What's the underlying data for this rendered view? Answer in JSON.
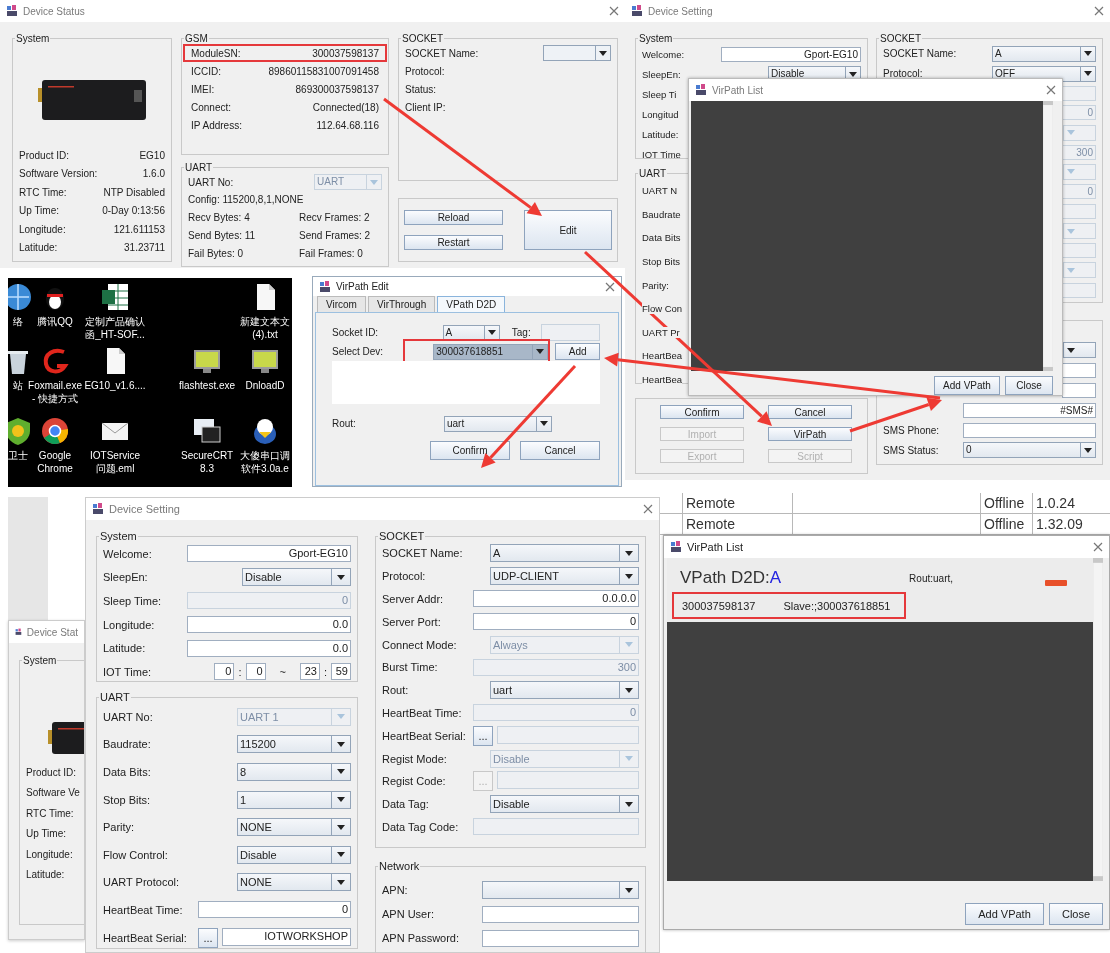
{
  "device_status": {
    "title": "Device Status",
    "system": {
      "title": "System",
      "rows": [
        {
          "label": "Product ID:",
          "value": "EG10"
        },
        {
          "label": "Software Version:",
          "value": "1.6.0"
        },
        {
          "label": "RTC Time:",
          "value": "NTP Disabled"
        },
        {
          "label": "Up Time:",
          "value": "0-Day 0:13:56"
        },
        {
          "label": "Longitude:",
          "value": "121.611153"
        },
        {
          "label": "Latitude:",
          "value": "31.23711"
        }
      ]
    },
    "gsm": {
      "title": "GSM",
      "rows": [
        {
          "label": "ModuleSN:",
          "value": "300037598137",
          "highlighted": true
        },
        {
          "label": "ICCID:",
          "value": "89860115831007091458",
          "highlighted": false
        },
        {
          "label": "IMEI:",
          "value": "869300037598137",
          "highlighted": false
        },
        {
          "label": "Connect:",
          "value": "Connected(18)",
          "highlighted": false
        },
        {
          "label": "IP Address:",
          "value": "112.64.68.116",
          "highlighted": false
        }
      ]
    },
    "uart": {
      "title": "UART",
      "uart_no": {
        "label": "UART No:",
        "kind": "select",
        "value": "UART",
        "disabled": true
      },
      "config": "Config: 115200,8,1,NONE",
      "stats": [
        [
          "Recv Bytes: 4",
          "Recv Frames: 2"
        ],
        [
          "Send Bytes: 11",
          "Send Frames: 2"
        ],
        [
          "Fail Bytes: 0",
          "Fail Frames: 0"
        ]
      ]
    },
    "socket": {
      "title": "SOCKET",
      "name_field": {
        "label": "SOCKET Name:",
        "kind": "select",
        "disabled": false
      },
      "labels": [
        "Protocol:",
        "Status:",
        "Client IP:"
      ]
    },
    "buttons": [
      "Reload",
      "Restart",
      "Edit"
    ]
  },
  "device_setting_top": {
    "title": "Device Setting",
    "system": {
      "title": "System",
      "rows": [
        {
          "label": "Welcome:",
          "kind": "input",
          "value": "Gport-EG10",
          "disabled": false
        },
        {
          "label": "SleepEn:",
          "kind": "select",
          "value": "Disable",
          "disabled": false
        },
        {
          "label": "Sleep Ti"
        },
        {
          "label": "Longitud"
        },
        {
          "label": "Latitude:"
        },
        {
          "label": "IOT Time"
        }
      ]
    },
    "uart": {
      "title": "UART",
      "rows": [
        {
          "label": "UART N"
        },
        {
          "label": "Baudrate"
        },
        {
          "label": "Data Bits"
        },
        {
          "label": "Stop Bits"
        },
        {
          "label": "Parity:"
        },
        {
          "label": "Flow Con"
        },
        {
          "label": "UART Pr"
        },
        {
          "label": "HeartBea"
        },
        {
          "label": "HeartBea"
        }
      ]
    },
    "socket": {
      "title": "SOCKET",
      "rows": [
        {
          "label": "SOCKET Name:",
          "kind": "select",
          "value": "A",
          "disabled": false
        },
        {
          "label": "Protocol:",
          "kind": "select",
          "value": "OFF",
          "disabled": false
        },
        {
          "kind": "stub_input",
          "disabled": true
        },
        {
          "kind": "stub_input",
          "value": "0",
          "disabled": true
        },
        {
          "kind": "stub_select",
          "disabled": true
        },
        {
          "kind": "stub_input",
          "value": "300",
          "disabled": true
        },
        {
          "kind": "stub_select",
          "disabled": true
        },
        {
          "kind": "stub_input",
          "value": "0",
          "disabled": true
        },
        {
          "kind": "stub_input",
          "disabled": true
        },
        {
          "kind": "stub_select",
          "disabled": true
        },
        {
          "kind": "stub_input",
          "disabled": true
        },
        {
          "kind": "stub_select",
          "disabled": true
        },
        {
          "kind": "stub_input",
          "disabled": true
        }
      ]
    },
    "sms": {
      "rows": [
        {
          "kind": "stub_select",
          "disabled": false
        },
        {
          "kind": "stub_input",
          "disabled": false
        },
        {
          "kind": "stub_input",
          "disabled": false
        },
        {
          "kind": "input",
          "value": "#SMS#",
          "disabled": false
        },
        {
          "label": "SMS Phone:",
          "kind": "input",
          "disabled": false
        },
        {
          "label": "SMS Status:",
          "kind": "select",
          "value": "0",
          "disabled": false
        }
      ]
    },
    "buttons": [
      {
        "label": "Confirm",
        "disabled": false
      },
      {
        "label": "Cancel",
        "disabled": false
      },
      {
        "label": "Import",
        "disabled": true
      },
      {
        "label": "VirPath",
        "disabled": false
      },
      {
        "label": "Export",
        "disabled": true
      },
      {
        "label": "Script",
        "disabled": true
      }
    ]
  },
  "virpath_list_top": {
    "title": "VirPath List",
    "buttons": [
      "Add VPath",
      "Close"
    ]
  },
  "desktop": {
    "icons": [
      {
        "kind": "globe",
        "label": "络"
      },
      {
        "kind": "penguin",
        "label": "腾讯QQ"
      },
      {
        "kind": "spreadsheet",
        "label": "定制产品确认函_HT-SOF..."
      },
      {
        "kind": "blank"
      },
      {
        "kind": "blank"
      },
      {
        "kind": "document",
        "label": "新建文本文\n(4).txt"
      },
      {
        "kind": "bin",
        "label": "站"
      },
      {
        "kind": "swoosh",
        "label": "Foxmail.exe\n- 快捷方式"
      },
      {
        "kind": "document",
        "label": "EG10_v1.6...."
      },
      {
        "kind": "blank"
      },
      {
        "kind": "monitor",
        "label": "flashtest.exe"
      },
      {
        "kind": "monitor",
        "label": "DnloadD"
      },
      {
        "kind": "shield",
        "label": "卫士"
      },
      {
        "kind": "browser",
        "label": "Google\nChrome"
      },
      {
        "kind": "envelope",
        "label": "IOTService\n问题.eml"
      },
      {
        "kind": "blank"
      },
      {
        "kind": "terminal",
        "label": "SecureCRT\n8.3"
      },
      {
        "kind": "bird",
        "label": "大傻串口调软件3.0a.e"
      }
    ]
  },
  "virpath_edit": {
    "title": "VirPath Edit",
    "tabs": [
      {
        "label": "Vircom",
        "selected": false
      },
      {
        "label": "VirThrough",
        "selected": false
      },
      {
        "label": "VPath D2D",
        "selected": true
      }
    ],
    "socket_id": {
      "label": "Socket ID:",
      "kind": "select",
      "value": "A",
      "disabled": false
    },
    "tag": {
      "label": "Tag:",
      "kind": "input",
      "disabled": true
    },
    "select_dev": {
      "label": "Select Dev:",
      "kind": "select",
      "value": "300037618851",
      "disabled": false,
      "highlighted": true
    },
    "add_button": "Add",
    "rout": {
      "label": "Rout:",
      "kind": "select",
      "value": "uart",
      "disabled": false
    },
    "buttons": [
      "Confirm",
      "Cancel"
    ]
  },
  "device_status_back": {
    "title": "Device Stat",
    "system_title": "System",
    "labels": [
      "Product ID:",
      "Software Ve",
      "RTC Time:",
      "Up Time:",
      "Longitude:",
      "Latitude:"
    ]
  },
  "device_setting": {
    "title": "Device Setting",
    "system": {
      "title": "System",
      "rows": [
        {
          "label": "Welcome:",
          "kind": "input",
          "value": "Gport-EG10",
          "disabled": false
        },
        {
          "label": "SleepEn:",
          "kind": "select",
          "value": "Disable",
          "disabled": false
        },
        {
          "label": "Sleep Time:",
          "kind": "input",
          "value": "0",
          "disabled": true
        },
        {
          "label": "Longitude:",
          "kind": "input",
          "value": "0.0",
          "disabled": false
        },
        {
          "label": "Latitude:",
          "kind": "input",
          "value": "0.0",
          "disabled": false
        },
        {
          "label": "IOT Time:",
          "kind": "time",
          "fields": [
            "0",
            "0",
            "23",
            "59"
          ],
          "separators": [
            ":",
            "~",
            ":"
          ]
        }
      ]
    },
    "uart": {
      "title": "UART",
      "rows": [
        {
          "label": "UART No:",
          "kind": "select",
          "value": "UART 1",
          "disabled": true
        },
        {
          "label": "Baudrate:",
          "kind": "select",
          "value": "115200",
          "disabled": false
        },
        {
          "label": "Data Bits:",
          "kind": "select",
          "value": "8",
          "disabled": false
        },
        {
          "label": "Stop Bits:",
          "kind": "select",
          "value": "1",
          "disabled": false
        },
        {
          "label": "Parity:",
          "kind": "select",
          "value": "NONE",
          "disabled": false
        },
        {
          "label": "Flow Control:",
          "kind": "select",
          "value": "Disable",
          "disabled": false
        },
        {
          "label": "UART Protocol:",
          "kind": "select",
          "value": "NONE",
          "disabled": false
        },
        {
          "label": "HeartBeat Time:",
          "kind": "input",
          "value": "0",
          "disabled": false
        },
        {
          "label": "HeartBeat Serial:",
          "kind": "serial",
          "button": "...",
          "button_disabled": false,
          "value": "IOTWORKSHOP",
          "disabled": false
        }
      ]
    },
    "socket": {
      "title": "SOCKET",
      "rows": [
        {
          "label": "SOCKET Name:",
          "kind": "select",
          "value": "A",
          "disabled": false
        },
        {
          "label": "Protocol:",
          "kind": "select",
          "value": "UDP-CLIENT",
          "disabled": false
        },
        {
          "label": "Server Addr:",
          "kind": "input",
          "value": "0.0.0.0",
          "disabled": false
        },
        {
          "label": "Server Port:",
          "kind": "input",
          "value": "0",
          "disabled": false
        },
        {
          "label": "Connect Mode:",
          "kind": "select",
          "value": "Always",
          "disabled": true
        },
        {
          "label": "Burst Time:",
          "kind": "input",
          "value": "300",
          "disabled": true
        },
        {
          "label": "Rout:",
          "kind": "select",
          "value": "uart",
          "disabled": false
        },
        {
          "label": "HeartBeat Time:",
          "kind": "input",
          "value": "0",
          "disabled": true
        },
        {
          "label": "HeartBeat Serial:",
          "kind": "serial",
          "button": "...",
          "button_disabled": false,
          "disabled": true
        },
        {
          "label": "Regist Mode:",
          "kind": "select",
          "value": "Disable",
          "disabled": true
        },
        {
          "label": "Regist Code:",
          "kind": "serial",
          "button": "...",
          "button_disabled": true,
          "disabled": true
        },
        {
          "label": "Data Tag:",
          "kind": "select",
          "value": "Disable",
          "disabled": false
        },
        {
          "label": "Data Tag Code:",
          "kind": "input",
          "disabled": true
        }
      ]
    },
    "network": {
      "title": "Network",
      "rows": [
        {
          "label": "APN:",
          "kind": "select",
          "disabled": false
        },
        {
          "label": "APN User:",
          "kind": "input",
          "disabled": false
        },
        {
          "label": "APN Password:",
          "kind": "input",
          "disabled": false
        }
      ]
    }
  },
  "device_table": {
    "rows": [
      {
        "column_2": "Remote",
        "column_4": "Offline",
        "column_5": "1.0.24"
      },
      {
        "column_2": "Remote",
        "column_4": "Offline",
        "column_5": "1.32.09"
      }
    ]
  },
  "virpath_list": {
    "title": "VirPath List",
    "entry": {
      "heading": "VPath D2D:",
      "socket": "A",
      "rout": "Rout:uart,",
      "master": "300037598137",
      "slave": "Slave:;300037618851",
      "highlighted": true
    },
    "buttons": [
      "Add VPath",
      "Close"
    ]
  }
}
